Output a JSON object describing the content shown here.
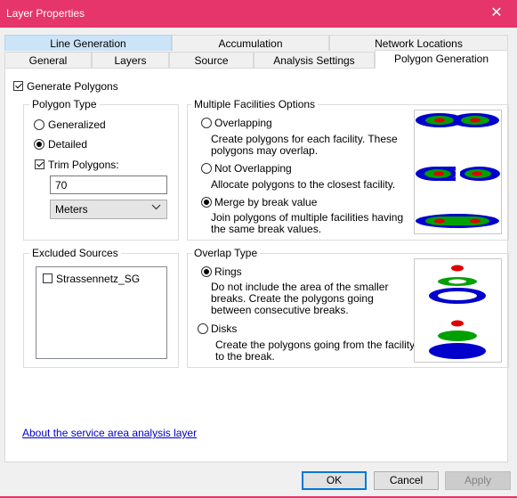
{
  "window": {
    "title": "Layer Properties",
    "close_glyph": "✕"
  },
  "tabs_row1": [
    "Line Generation",
    "Accumulation",
    "Network Locations"
  ],
  "tabs_row2": [
    "General",
    "Layers",
    "Source",
    "Analysis Settings",
    "Polygon Generation"
  ],
  "generate_polygons": {
    "label": "Generate Polygons",
    "checked": true
  },
  "polygon_type": {
    "legend": "Polygon Type",
    "generalized": "Generalized",
    "detailed": "Detailed",
    "selected": "Detailed",
    "trim_label": "Trim Polygons:",
    "trim_checked": true,
    "trim_value": "70",
    "unit": "Meters"
  },
  "multiple_facilities": {
    "legend": "Multiple Facilities Options",
    "options": [
      {
        "label": "Overlapping",
        "desc": "Create polygons for each facility. These polygons may overlap.",
        "selected": false
      },
      {
        "label": "Not Overlapping",
        "desc": "Allocate polygons to the closest facility.",
        "selected": false
      },
      {
        "label": "Merge by break value",
        "desc": "Join polygons of multiple facilities having the same break values.",
        "selected": true
      }
    ]
  },
  "excluded_sources": {
    "legend": "Excluded Sources",
    "items": [
      {
        "label": "Strassennetz_SG",
        "checked": false
      }
    ]
  },
  "overlap_type": {
    "legend": "Overlap Type",
    "options": [
      {
        "label": "Rings",
        "desc": "Do not include the area of the smaller breaks. Create the polygons going between consecutive breaks.",
        "selected": true
      },
      {
        "label": "Disks",
        "desc": "Create the polygons going from the facility to the break.",
        "selected": false
      }
    ]
  },
  "link": "About the service area analysis layer",
  "buttons": {
    "ok": "OK",
    "cancel": "Cancel",
    "apply": "Apply"
  },
  "colors": {
    "titlebar": "#e5356a",
    "blue": "#0000cc",
    "green": "#00a000",
    "red": "#e00000"
  }
}
